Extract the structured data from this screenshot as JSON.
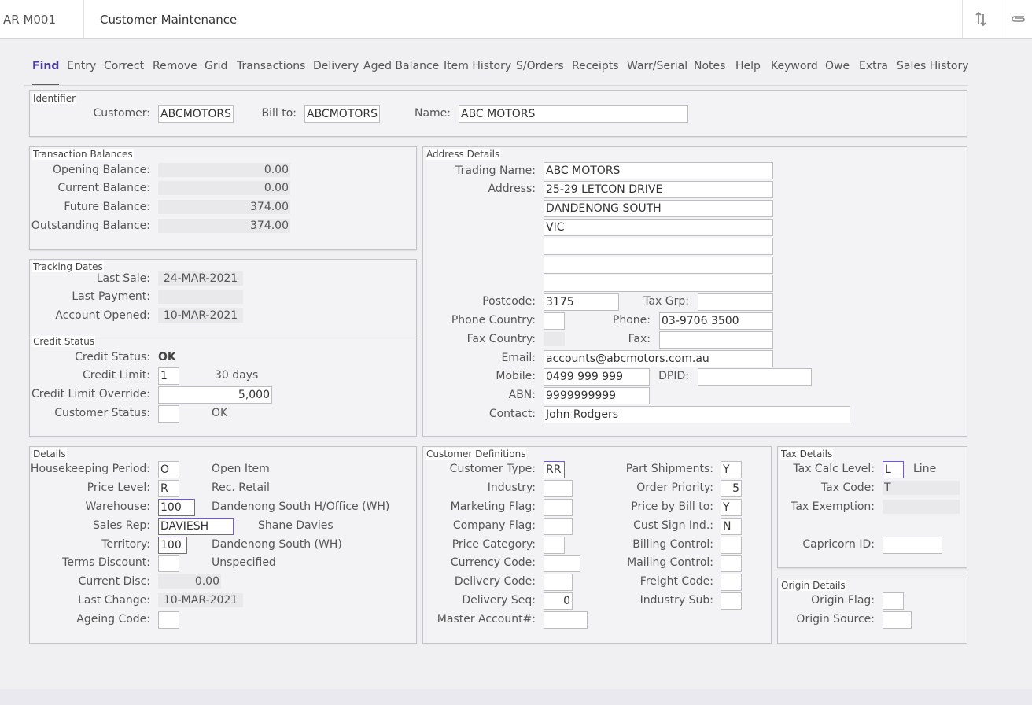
{
  "header": {
    "program": "AR M001",
    "title": "Customer Maintenance"
  },
  "tabs": [
    "Find",
    "Entry",
    "Correct",
    "Remove",
    "Grid",
    "Transactions",
    "Delivery",
    "Aged Balance",
    "Item History",
    "S/Orders",
    "Receipts",
    "Warr/Serial",
    "Notes",
    "Help",
    "Keyword",
    "Owe",
    "Extra",
    "Sales History"
  ],
  "identifier": {
    "title": "Identifier",
    "customer_label": "Customer:",
    "customer": "ABCMOTORS",
    "billto_label": "Bill to:",
    "billto": "ABCMOTORS",
    "name_label": "Name:",
    "name": "ABC MOTORS"
  },
  "balances": {
    "title": "Transaction Balances",
    "opening_label": "Opening Balance:",
    "opening": "0.00",
    "current_label": "Current Balance:",
    "current": "0.00",
    "future_label": "Future Balance:",
    "future": "374.00",
    "outstanding_label": "Outstanding Balance:",
    "outstanding": "374.00"
  },
  "tracking": {
    "title": "Tracking Dates",
    "lastsale_label": "Last Sale:",
    "lastsale": "24-MAR-2021",
    "lastpay_label": "Last Payment:",
    "lastpay": "",
    "opened_label": "Account Opened:",
    "opened": "10-MAR-2021"
  },
  "credit": {
    "title": "Credit Status",
    "status_label": "Credit Status:",
    "status": "OK",
    "limit_label": "Credit Limit:",
    "limit": "1",
    "limit_desc": "30 days",
    "override_label": "Credit Limit Override:",
    "override": "5,000",
    "custstatus_label": "Customer Status:",
    "custstatus": "",
    "custstatus_desc": "OK"
  },
  "address": {
    "title": "Address Details",
    "trading_label": "Trading Name:",
    "trading": "ABC MOTORS",
    "address_label": "Address:",
    "lines": [
      "25-29 LETCON DRIVE",
      "DANDENONG SOUTH",
      "VIC",
      "",
      "",
      ""
    ],
    "postcode_label": "Postcode:",
    "postcode": "3175",
    "taxgrp_label": "Tax Grp:",
    "taxgrp": "",
    "phonecountry_label": "Phone Country:",
    "phonecountry": "",
    "phone_label": "Phone:",
    "phone": "03-9706 3500",
    "faxcountry_label": "Fax Country:",
    "faxcountry": "",
    "fax_label": "Fax:",
    "fax": "",
    "email_label": "Email:",
    "email": "accounts@abcmotors.com.au",
    "mobile_label": "Mobile:",
    "mobile": "0499 999 999",
    "dpid_label": "DPID:",
    "dpid": "",
    "abn_label": "ABN:",
    "abn": "9999999999",
    "contact_label": "Contact:",
    "contact": "John Rodgers"
  },
  "details": {
    "title": "Details",
    "hk_label": "Housekeeping Period:",
    "hk": "O",
    "hk_desc": "Open Item",
    "price_label": "Price Level:",
    "price": "R",
    "price_desc": "Rec. Retail",
    "wh_label": "Warehouse:",
    "wh": "100",
    "wh_desc": "Dandenong South H/Office (WH)",
    "rep_label": "Sales Rep:",
    "rep": "DAVIESH",
    "rep_desc": "Shane Davies",
    "terr_label": "Territory:",
    "terr": "100",
    "terr_desc": "Dandenong South (WH)",
    "terms_label": "Terms Discount:",
    "terms": "",
    "terms_desc": "Unspecified",
    "curdisc_label": "Current Disc:",
    "curdisc": "0.00",
    "lastchange_label": "Last Change:",
    "lastchange": "10-MAR-2021",
    "ageing_label": "Ageing Code:",
    "ageing": ""
  },
  "custdef": {
    "title": "Customer Definitions",
    "type_label": "Customer Type:",
    "type": "RR",
    "industry_label": "Industry:",
    "industry": "",
    "marketing_label": "Marketing Flag:",
    "marketing": "",
    "company_label": "Company Flag:",
    "company": "",
    "pricecat_label": "Price Category:",
    "pricecat": "",
    "currency_label": "Currency Code:",
    "currency": "",
    "delcode_label": "Delivery Code:",
    "delcode": "",
    "delseq_label": "Delivery Seq:",
    "delseq": "0",
    "master_label": "Master Account#:",
    "master": "",
    "partship_label": "Part Shipments:",
    "partship": "Y",
    "priority_label": "Order Priority:",
    "priority": "5",
    "pricebill_label": "Price by Bill to:",
    "pricebill": "Y",
    "sign_label": "Cust Sign Ind.:",
    "sign": "N",
    "billing_label": "Billing Control:",
    "billing": "",
    "mailing_label": "Mailing Control:",
    "mailing": "",
    "freight_label": "Freight Code:",
    "freight": "",
    "indsub_label": "Industry Sub:",
    "indsub": ""
  },
  "tax": {
    "title": "Tax Details",
    "calc_label": "Tax Calc Level:",
    "calc": "L",
    "calc_desc": "Line",
    "code_label": "Tax Code:",
    "code": "T",
    "exempt_label": "Tax Exemption:",
    "exempt": "",
    "capricorn_label": "Capricorn ID:",
    "capricorn": ""
  },
  "origin": {
    "title": "Origin Details",
    "flag_label": "Origin Flag:",
    "flag": "",
    "source_label": "Origin Source:",
    "source": ""
  },
  "colors": {
    "accent": "#5c4db1",
    "active_tab": "#4a3b96"
  }
}
